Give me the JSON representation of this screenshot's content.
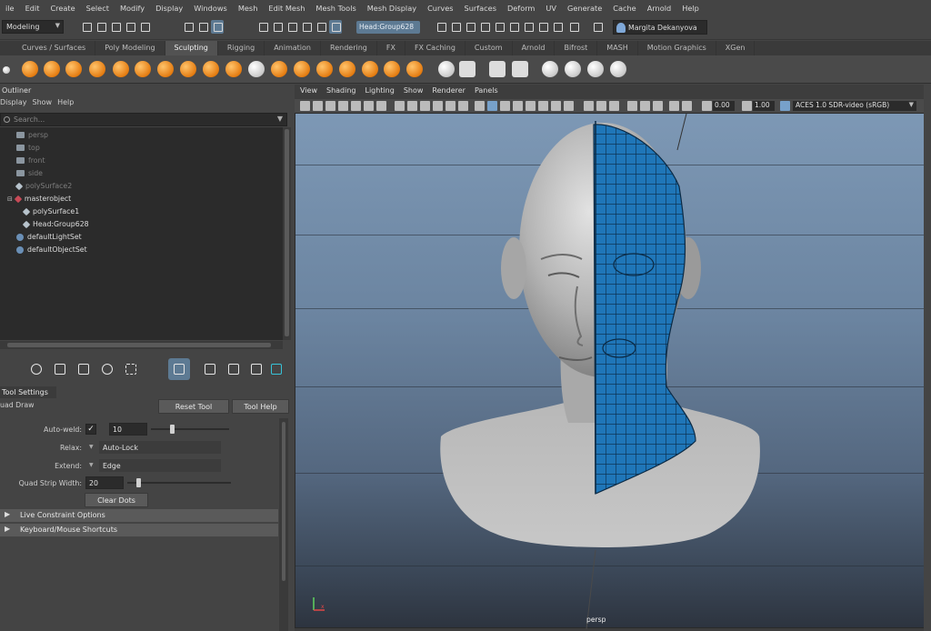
{
  "menubar": [
    "ile",
    "Edit",
    "Create",
    "Select",
    "Modify",
    "Display",
    "Windows",
    "Mesh",
    "Edit Mesh",
    "Mesh Tools",
    "Mesh Display",
    "Curves",
    "Surfaces",
    "Deform",
    "UV",
    "Generate",
    "Cache",
    "Arnold",
    "Help"
  ],
  "status": {
    "mode": "Modeling",
    "selection_field": "Head:Group628",
    "user": "Margita Dekanyova"
  },
  "shelf_tabs": [
    "Curves / Surfaces",
    "Poly Modeling",
    "Sculpting",
    "Rigging",
    "Animation",
    "Rendering",
    "FX",
    "FX Caching",
    "Custom",
    "Arnold",
    "Bifrost",
    "MASH",
    "Motion Graphics",
    "XGen"
  ],
  "shelf_active_tab": "Sculpting",
  "outliner": {
    "title": "Outliner",
    "menu": [
      "Display",
      "Show",
      "Help"
    ],
    "search_placeholder": "Search...",
    "items": [
      {
        "label": "persp",
        "icon": "camera-icon",
        "dim": true
      },
      {
        "label": "top",
        "icon": "camera-icon",
        "dim": true
      },
      {
        "label": "front",
        "icon": "camera-icon",
        "dim": true
      },
      {
        "label": "side",
        "icon": "camera-icon",
        "dim": true
      },
      {
        "label": "polySurface2",
        "icon": "mesh-icon",
        "dim": true
      },
      {
        "label": "masterobject",
        "icon": "group-icon",
        "dim": false
      },
      {
        "label": "polySurface1",
        "icon": "mesh-icon",
        "dim": false
      },
      {
        "label": "Head:Group628",
        "icon": "mesh-icon",
        "dim": false
      },
      {
        "label": "defaultLightSet",
        "icon": "set-icon",
        "dim": false
      },
      {
        "label": "defaultObjectSet",
        "icon": "set-icon",
        "dim": false
      }
    ]
  },
  "tool_settings": {
    "header": "Tool Settings",
    "tool_name": "uad Draw",
    "reset_label": "Reset Tool",
    "help_label": "Tool Help",
    "auto_weld_label": "Auto-weld:",
    "auto_weld_value": "10",
    "relax_label": "Relax:",
    "relax_value": "Auto-Lock",
    "extend_label": "Extend:",
    "extend_value": "Edge",
    "strip_label": "Quad Strip Width:",
    "strip_value": "20",
    "clear_label": "Clear Dots",
    "section1": "Live Constraint Options",
    "section2": "Keyboard/Mouse Shortcuts"
  },
  "viewport": {
    "menu": [
      "View",
      "Shading",
      "Lighting",
      "Show",
      "Renderer",
      "Panels"
    ],
    "exposure": "0.00",
    "gamma": "1.00",
    "color_space": "ACES 1.0 SDR-video (sRGB)",
    "camera": "persp"
  },
  "colors": {
    "selection_blue": "#5d7a93",
    "wire_blue": "#1f76b8",
    "shelf_orange": "#e57d12"
  }
}
